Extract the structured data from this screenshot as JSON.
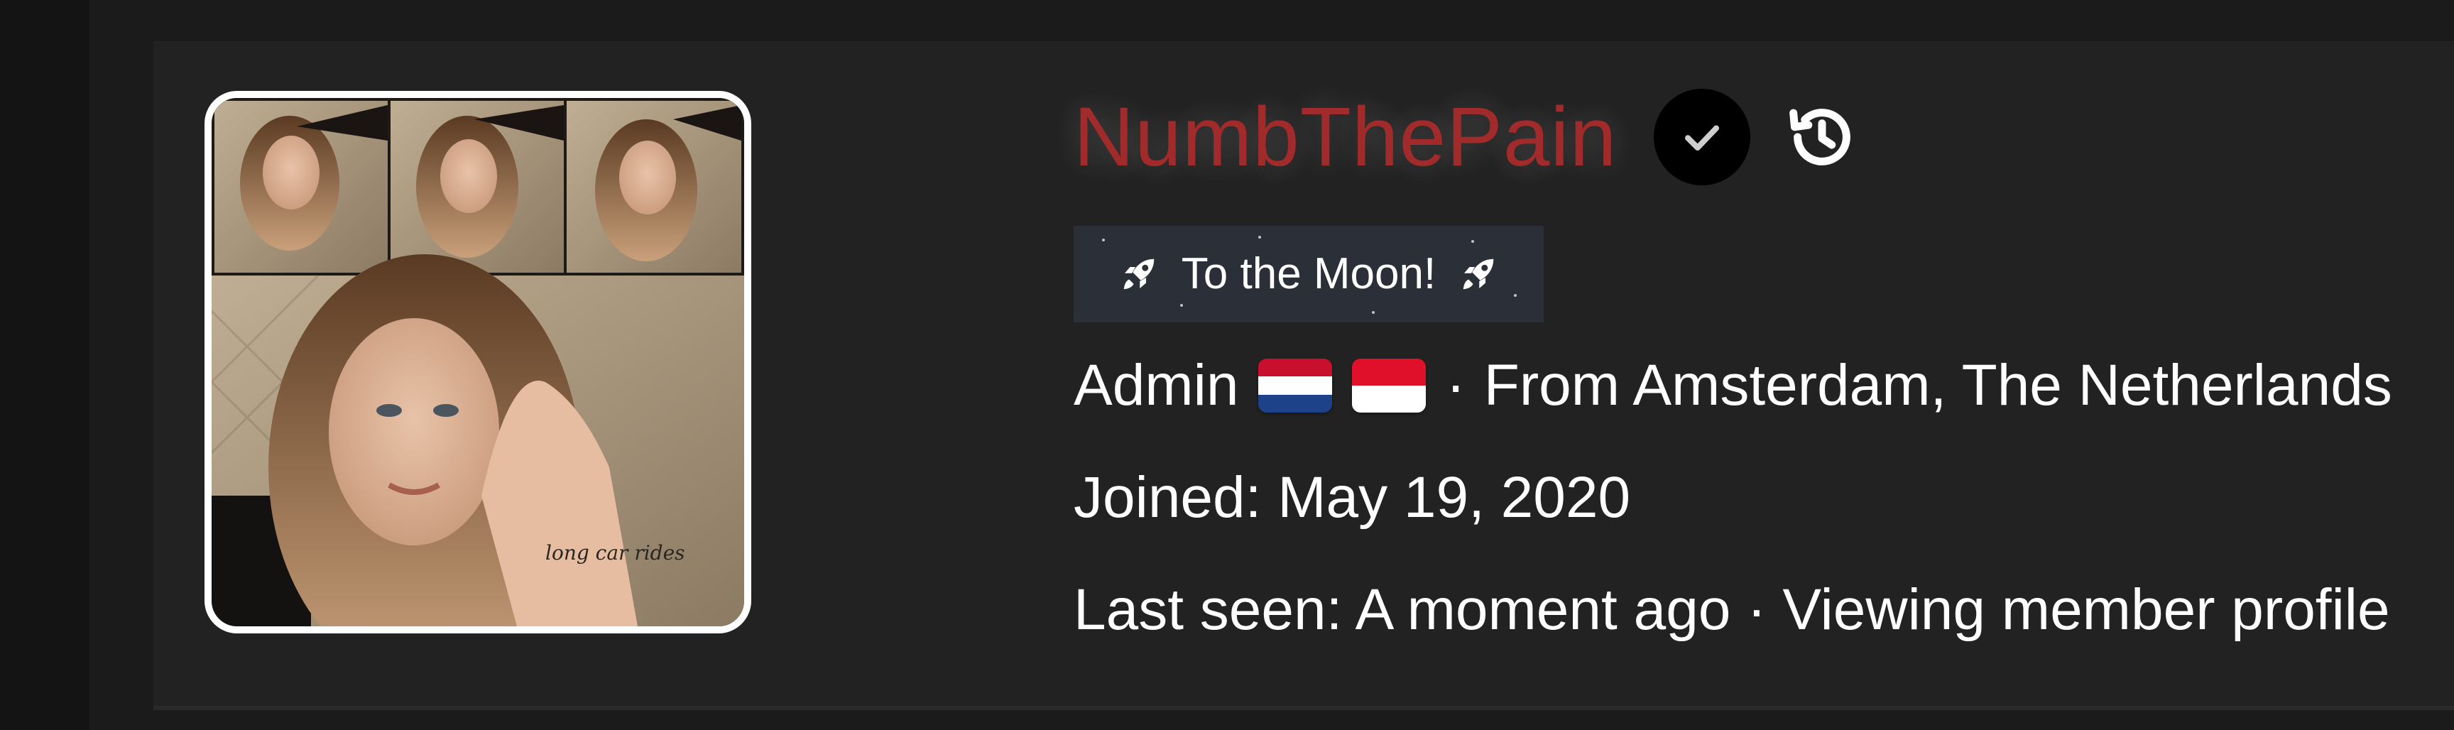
{
  "profile": {
    "username": "NumbThePain",
    "banner_text": "To the Moon!",
    "role": "Admin",
    "separator": "·",
    "location_text": "From Amsterdam, The Netherlands",
    "joined_label": "Joined:",
    "joined_date": "May 19, 2020",
    "last_seen_label": "Last seen:",
    "last_seen_value": "A moment ago",
    "activity_text": "Viewing member profile",
    "avatar_caption": "long car rides",
    "flags": [
      "netherlands-flag",
      "indonesia-flag"
    ],
    "icons": [
      "verified-check-icon",
      "history-icon",
      "rocket-icon"
    ]
  },
  "colors": {
    "username": "#a12a2a",
    "card_bg": "#222222",
    "banner_bg": "#2b3038",
    "avatar_border": "#ffffff",
    "text": "#ffffff"
  }
}
